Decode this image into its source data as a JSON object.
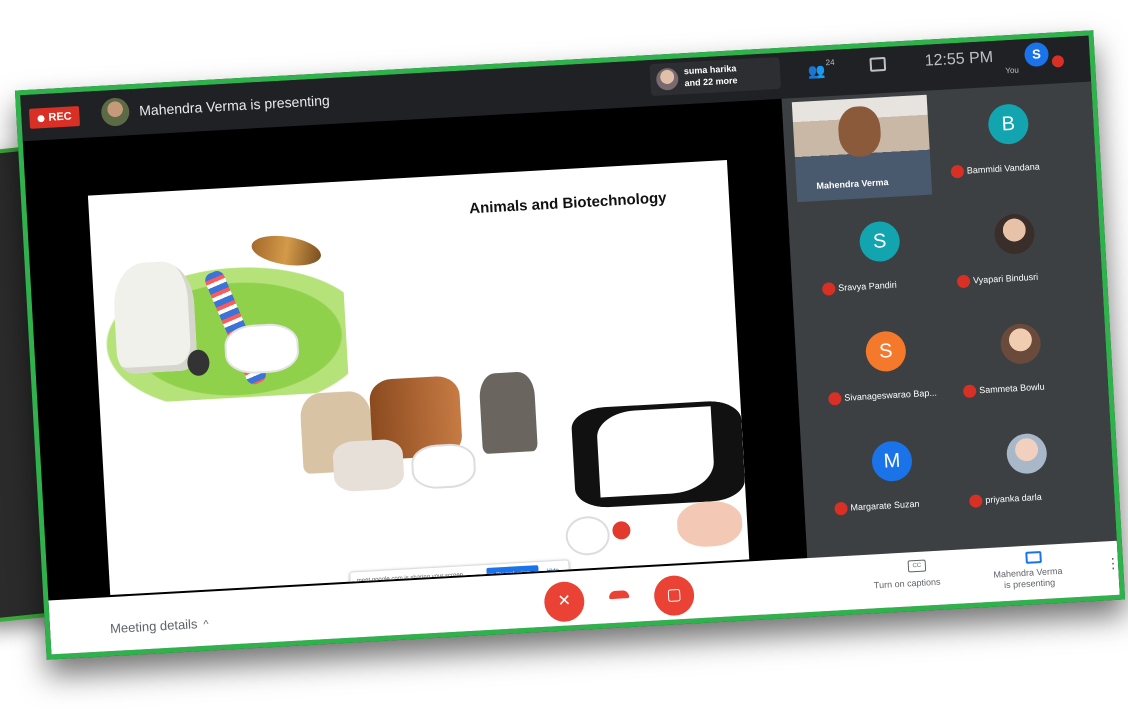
{
  "header": {
    "rec_label": "REC",
    "presenting_title": "Mahendra Verma is presenting",
    "others_line1": "suma harika",
    "others_line2": "and 22 more",
    "people_count": "24",
    "clock": "12:55 PM",
    "self_initial": "S",
    "self_label": "You"
  },
  "slide": {
    "title": "Animals and Biotechnology"
  },
  "share_banner": {
    "message": "meet.google.com is sharing your screen.",
    "stop_label": "Stop sharing",
    "hide_label": "Hide"
  },
  "participants": [
    {
      "name": "Mahendra Verma",
      "kind": "video"
    },
    {
      "name": "Bammidi Vandana",
      "initial": "B",
      "color": "#12a4af"
    },
    {
      "name": "Sravya Pandiri",
      "initial": "S",
      "color": "#12a4af"
    },
    {
      "name": "Vyapari Bindusri",
      "initial": "",
      "color": "#3a2e2a"
    },
    {
      "name": "Sivanageswarao Bap...",
      "initial": "S",
      "color": "#f4792b"
    },
    {
      "name": "Sammeta Bowlu",
      "initial": "",
      "color": "#6a4a3a"
    },
    {
      "name": "Margarate Suzan",
      "initial": "M",
      "color": "#1a73e8"
    },
    {
      "name": "priyanka darla",
      "initial": "",
      "color": "#a8b8c8"
    }
  ],
  "footer": {
    "meeting_details": "Meeting details",
    "captions_label": "Turn on captions",
    "cc_badge": "CC",
    "presenting_line1": "Mahendra Verma",
    "presenting_line2": "is presenting"
  },
  "colors": {
    "frame_border": "#2fb24c",
    "rec": "#d93025",
    "control_red": "#ea4335",
    "accent_blue": "#1a73e8"
  }
}
